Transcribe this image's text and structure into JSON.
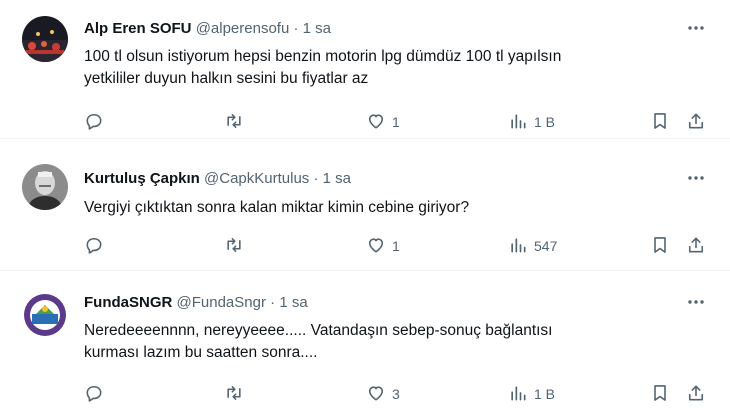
{
  "tweets": [
    {
      "name": "Alp Eren SOFU",
      "handle": "@alperensofu",
      "separator": "·",
      "time": "1 sa",
      "text_lines": [
        "100 tl olsun istiyorum hepsi benzin motorin lpg dümdüz 100 tl yapılsın",
        "yetkililer duyun halkın sesini bu fiyatlar az"
      ],
      "likes": "1",
      "views": "1 B"
    },
    {
      "name": "Kurtuluş Çapkın",
      "handle": "@CapkKurtulus",
      "separator": "·",
      "time": "1 sa",
      "text_lines": [
        "Vergiyi çıktıktan sonra kalan miktar kimin cebine giriyor?"
      ],
      "likes": "1",
      "views": "547"
    },
    {
      "name": "FundaSNGR",
      "handle": "@FundaSngr",
      "separator": "·",
      "time": "1 sa",
      "text_lines": [
        "Neredeeeennnn, nereyyeeee..... Vatandaşın sebep-sonuç bağlantısı",
        "kurması lazım bu saatten sonra...."
      ],
      "likes": "3",
      "views": "1 B"
    }
  ],
  "icons": {
    "reply": "reply-icon",
    "retweet": "retweet-icon",
    "like": "heart-icon",
    "views": "views-chart-icon",
    "bookmark": "bookmark-icon",
    "share": "share-icon",
    "more": "more-options-icon"
  },
  "colors": {
    "text": "#0f1419",
    "secondary": "#536471",
    "divider": "#eff3f4"
  }
}
